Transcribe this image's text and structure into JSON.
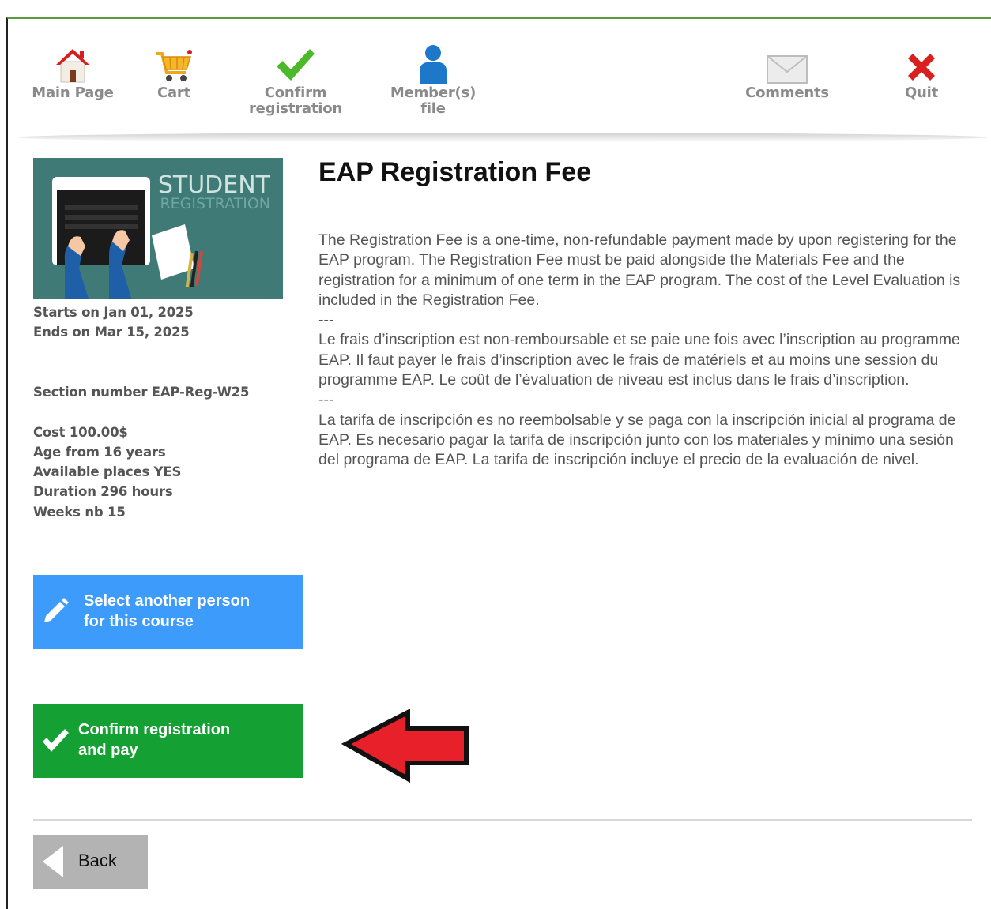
{
  "toolbar": {
    "main_page": "Main Page",
    "cart": "Cart",
    "confirm_line1": "Confirm",
    "confirm_line2": "registration",
    "members_line1": "Member(s)",
    "members_line2": "file",
    "comments": "Comments",
    "quit": "Quit"
  },
  "banner": {
    "line1": "STUDENT",
    "line2": "REGISTRATION"
  },
  "course": {
    "title": "EAP Registration Fee",
    "starts": "Starts on Jan 01, 2025",
    "ends": "Ends on Mar 15, 2025",
    "section": "Section number EAP-Reg-W25",
    "cost": "Cost 100.00$",
    "age": "Age from 16 years",
    "places": "Available places YES",
    "duration": "Duration 296 hours",
    "weeks": "Weeks nb 15",
    "description": [
      "The Registration Fee is a one-time, non-refundable payment made by upon registering for the EAP program. The Registration Fee must be paid alongside the Materials Fee and the registration for a minimum of one term in the EAP program. The cost of the Level Evaluation is included in the Registration Fee.",
      "---",
      "Le frais d’inscription est non-remboursable et se paie une fois avec l’inscription au programme EAP. Il faut payer le frais d’inscription avec le frais de matériels et au moins une session du programme EAP. Le coût de l’évaluation de niveau est inclus dans le frais d’inscription.",
      "---",
      "La tarifa de inscripción es no reembolsable y se paga con la inscripción inicial al programa de EAP. Es necesario pagar la tarifa de inscripción junto con los materiales y mínimo una sesión del programa de EAP. La tarifa de inscripción incluye el precio de la evaluación de nivel."
    ]
  },
  "buttons": {
    "select_line1": "Select another person",
    "select_line2": "for this course",
    "confirm_line1": "Confirm registration",
    "confirm_line2": "and pay",
    "back": "Back"
  },
  "colors": {
    "blue_button": "#3d9bfb",
    "green_button": "#14a032",
    "back_button": "#b3b3b3",
    "banner_bg": "#3f7a77",
    "arrow": "#e8202a"
  }
}
